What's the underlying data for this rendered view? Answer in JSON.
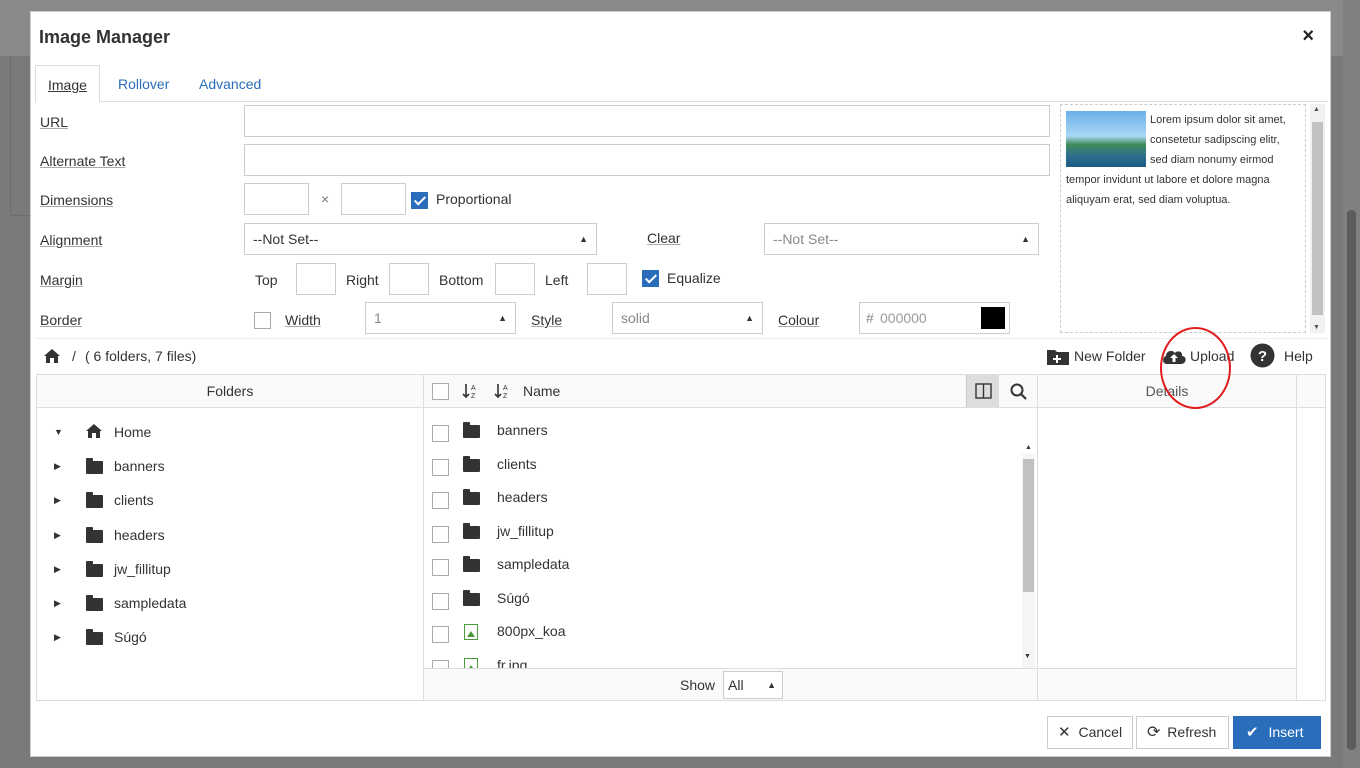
{
  "dialog": {
    "title": "Image Manager",
    "close": "×"
  },
  "tabs": [
    {
      "label": "Image"
    },
    {
      "label": "Rollover"
    },
    {
      "label": "Advanced"
    }
  ],
  "form": {
    "url_label": "URL",
    "alt_label": "Alternate Text",
    "dimensions_label": "Dimensions",
    "dimensions_x": "×",
    "proportional_label": "Proportional",
    "alignment_label": "Alignment",
    "alignment_value": "--Not Set--",
    "clear_label": "Clear",
    "clear_value": "--Not Set--",
    "margin_label": "Margin",
    "top_label": "Top",
    "right_label": "Right",
    "bottom_label": "Bottom",
    "left_label": "Left",
    "equalize_label": "Equalize",
    "border_label": "Border",
    "width_label": "Width",
    "width_value": "1",
    "style_label": "Style",
    "style_value": "solid",
    "colour_label": "Colour",
    "colour_hash": "#",
    "colour_placeholder": "000000",
    "colour_swatch": "#000000"
  },
  "preview": {
    "text": "Lorem ipsum dolor sit amet, consetetur sadipscing elitr, sed diam nonumy eirmod tempor invidunt ut labore et dolore magna aliquyam erat, sed diam voluptua."
  },
  "browser": {
    "path_sep": "/",
    "summary": "( 6 folders, 7 files)",
    "new_folder": "New Folder",
    "upload": "Upload",
    "help": "Help"
  },
  "panes": {
    "folders": "Folders",
    "name": "Name",
    "details": "Details"
  },
  "folders": [
    {
      "name": "Home"
    },
    {
      "name": "banners"
    },
    {
      "name": "clients"
    },
    {
      "name": "headers"
    },
    {
      "name": "jw_fillitup"
    },
    {
      "name": "sampledata"
    },
    {
      "name": "Súgó"
    }
  ],
  "files": [
    {
      "name": "banners",
      "kind": "folder"
    },
    {
      "name": "clients",
      "kind": "folder"
    },
    {
      "name": "headers",
      "kind": "folder"
    },
    {
      "name": "jw_fillitup",
      "kind": "folder"
    },
    {
      "name": "sampledata",
      "kind": "folder"
    },
    {
      "name": "Súgó",
      "kind": "folder"
    },
    {
      "name": "800px_koa",
      "kind": "image"
    },
    {
      "name": "fr.jpg",
      "kind": "image"
    }
  ],
  "show": {
    "label": "Show",
    "value": "All"
  },
  "buttons": {
    "cancel": "Cancel",
    "refresh": "Refresh",
    "insert": "Insert"
  },
  "colors": {
    "accent": "#2a6ebb",
    "annotation": "#e01c1c"
  }
}
